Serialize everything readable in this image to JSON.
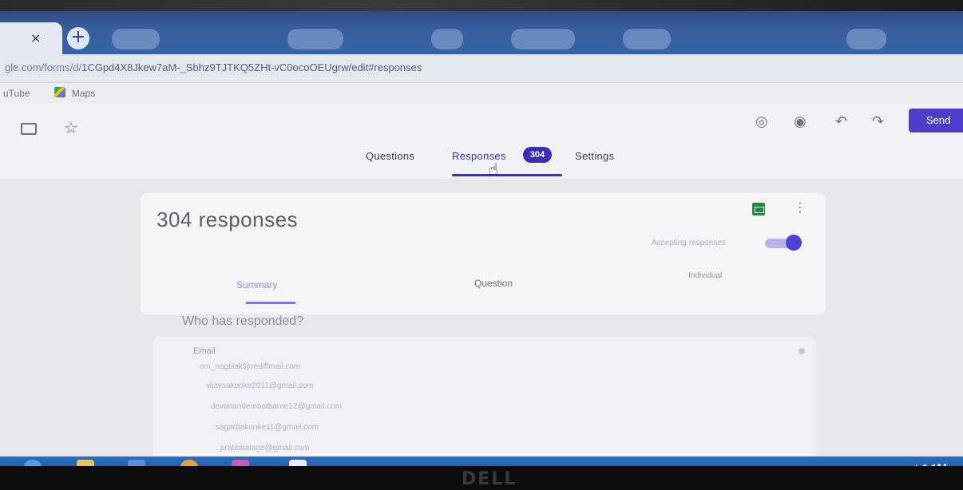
{
  "browser": {
    "tab_close_glyph": "×",
    "new_tab_glyph": "+",
    "url_host": "gle.com/forms/d/",
    "url_path": "1CGpd4X8Jkew7aM-_Sbhz9TJTKQ5ZHt-vC0ocoOEUgrw/edit#responses",
    "bookmarks": [
      {
        "label": "uTube"
      },
      {
        "label": "Maps",
        "icon": "maps-icon"
      }
    ]
  },
  "forms_header": {
    "tabs": [
      {
        "label": "Questions"
      },
      {
        "label": "Responses",
        "active": true
      },
      {
        "label": "Settings"
      }
    ],
    "responses_count_badge": "304",
    "send_label": "Send",
    "icons": [
      "palette-icon",
      "preview-icon",
      "undo-icon",
      "redo-icon"
    ]
  },
  "summary_card": {
    "title": "304 responses",
    "accepting_label": "Accepting responses",
    "accepting": true,
    "subtabs": [
      {
        "label": "Summary",
        "active": true
      },
      {
        "label": "Question"
      },
      {
        "label": "Individual"
      }
    ]
  },
  "respondents": {
    "heading": "Who has responded?",
    "field_label": "Email",
    "emails": [
      "om_nagtilak@rediffmail.com",
      "vijaysakunke2011@gmail.com",
      "devanandembatbarne12@gmail.com",
      "sagarbakunke11@gmail.com",
      "pratibhatage@gmail.com"
    ]
  },
  "colors": {
    "accent": "#3b2fb8",
    "toggle_on": "#4f42d4",
    "sheets_green": "#1e8e3e"
  },
  "monitor_brand": "DELL"
}
